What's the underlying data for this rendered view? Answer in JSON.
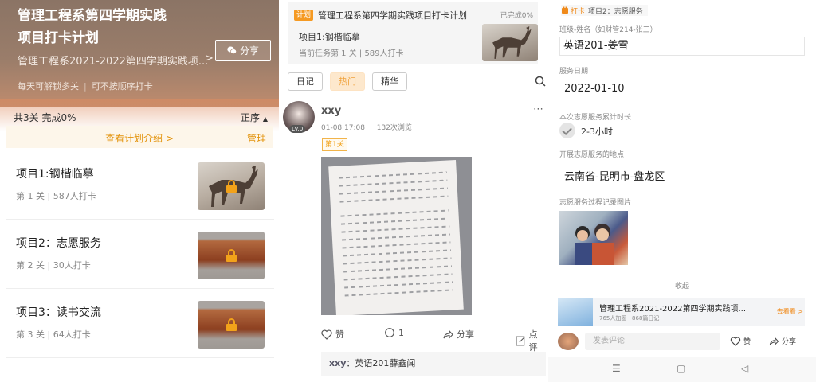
{
  "panel1": {
    "title": "管理工程系第四学期实践项目打卡计划",
    "subtitle": "管理工程系2021-2022第四学期实践项...",
    "arrow": ">",
    "share": "分享",
    "tag1": "每天可解锁多关",
    "tag_sep": "|",
    "tag2": "可不按顺序打卡",
    "stats": "共3关   完成0%",
    "order": "正序",
    "intro": "查看计划介绍 >",
    "manage": "管理",
    "projects": [
      {
        "name": "项目1:钢楷临摹",
        "level": "第 1 关",
        "sep": "|",
        "count": "587人打卡"
      },
      {
        "name": "项目2：志愿服务",
        "level": "第 2 关",
        "sep": "|",
        "count": "30人打卡"
      },
      {
        "name": "项目3：读书交流",
        "level": "第 3 关",
        "sep": "|",
        "count": "64人打卡"
      }
    ]
  },
  "panel2": {
    "badge": "计划",
    "plan_title": "管理工程系第四学期实践项目打卡计划",
    "done": "已完成0%",
    "project": "项目1:钢楷临摹",
    "task": "当前任务第 1 关 | 589人打卡",
    "tabs": [
      "日记",
      "热门",
      "精华"
    ],
    "user": "xxy",
    "level_badge": "Lv.0",
    "time": "01-08 17:08",
    "views": "132次浏览",
    "stage": "第1关",
    "like": "赞",
    "comment_count": "1",
    "share": "分享",
    "review": "点评",
    "comment_user": "xxy",
    "comment_text": "：英语201薛鑫闻"
  },
  "panel3": {
    "tag": "打卡",
    "crumb": "项目2：志愿服务",
    "name_label": "班级-姓名（如财管214-张三）",
    "name_value": "英语201-姜雪",
    "date_label": "服务日期",
    "date_value": "2022-01-10",
    "hours_label": "本次志愿服务累计时长",
    "hours_value": "2-3小时",
    "place_label": "开展志愿服务的地点",
    "place_value": "云南省-昆明市-盘龙区",
    "photo_label": "志愿服务过程记录图片",
    "collapse": "收起",
    "card_title": "管理工程系2021-2022第四学期实践项...",
    "card_meta": "765人加圈 · 868篇日记",
    "card_go": "去看看 >",
    "comment_placeholder": "发表评论",
    "like": "赞",
    "share": "分享"
  },
  "colors": {
    "accent": "#f59a23",
    "brand_orange": "#e3930b"
  }
}
